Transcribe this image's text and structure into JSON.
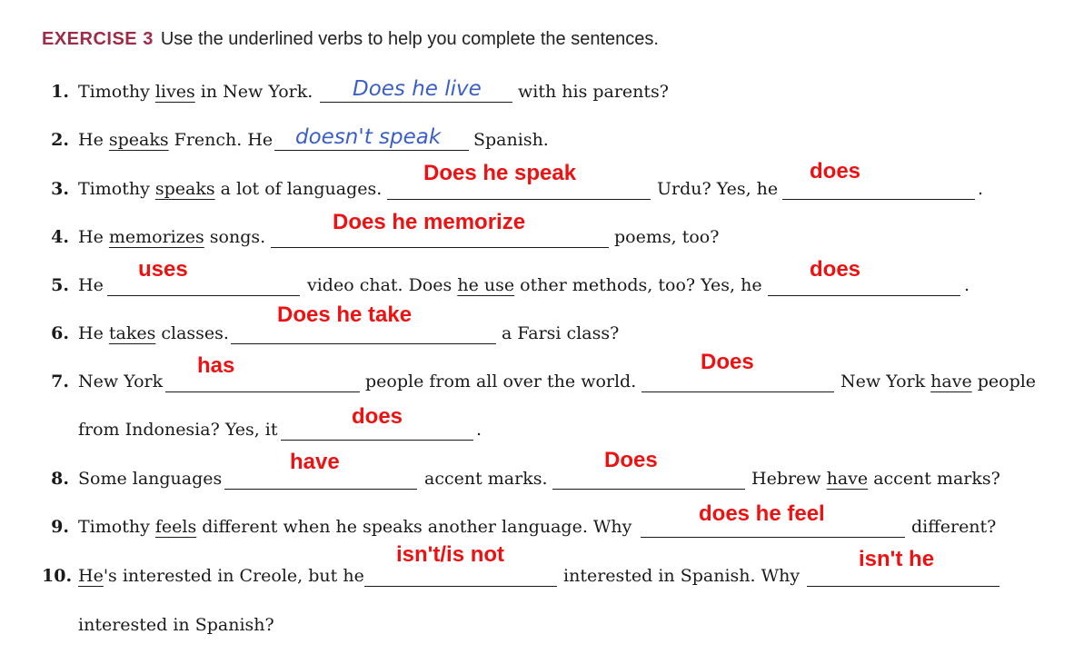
{
  "header": {
    "label": "EXERCISE 3",
    "instruction": "Use the underlined verbs to help you complete the sentences."
  },
  "q1": {
    "num": "1.",
    "a": "Timothy ",
    "b": "lives",
    "c": " in New York.",
    "d": "with his parents?",
    "hand": "Does he live"
  },
  "q2": {
    "num": "2.",
    "a": "He ",
    "b": "speaks",
    "c": " French. He",
    "d": "Spanish.",
    "hand": "doesn't speak"
  },
  "q3": {
    "num": "3.",
    "a": "Timothy ",
    "b": "speaks",
    "c": " a lot of languages.",
    "d": "Urdu? Yes, he",
    "e": ".",
    "ans1": "Does he speak",
    "ans2": "does"
  },
  "q4": {
    "num": "4.",
    "a": "He ",
    "b": "memorizes",
    "c": " songs.",
    "d": "poems, too?",
    "ans1": "Does he memorize"
  },
  "q5": {
    "num": "5.",
    "a": "He",
    "b": "video chat. Does ",
    "c": "he use",
    "d": " other methods, too? Yes, he",
    "e": ".",
    "ans1": "uses",
    "ans2": "does"
  },
  "q6": {
    "num": "6.",
    "a": "He ",
    "b": "takes",
    "c": " classes.",
    "d": "a Farsi class?",
    "ans1": "Does he take"
  },
  "q7": {
    "num": "7.",
    "a": "New York",
    "b": "people from all over the world.",
    "c": "New York ",
    "d": "have",
    "e": " people",
    "f": "from Indonesia? Yes, it",
    "g": ".",
    "ans1": "has",
    "ans2": "Does",
    "ans3": "does"
  },
  "q8": {
    "num": "8.",
    "a": "Some languages",
    "b": "accent marks.",
    "c": "Hebrew ",
    "d": "have",
    "e": " accent marks?",
    "ans1": "have",
    "ans2": "Does"
  },
  "q9": {
    "num": "9.",
    "a": "Timothy ",
    "b": "feels",
    "c": " different when he speaks another language. Why",
    "d": "different?",
    "ans1": "does he feel"
  },
  "q10": {
    "num": "10.",
    "a": "He",
    "b": "'s",
    "c": " interested in Creole, but he",
    "d": "interested in Spanish. Why",
    "e": "interested in Spanish?",
    "ans1": "isn't/is not",
    "ans2": "isn't he"
  }
}
